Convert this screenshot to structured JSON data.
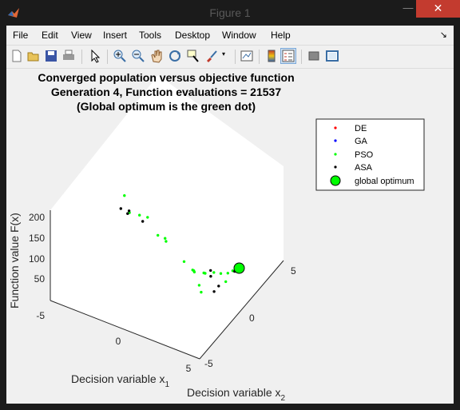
{
  "window": {
    "title": "Figure 1",
    "minimize": "—",
    "maximize": "☐",
    "close": "✕"
  },
  "menu": [
    {
      "label": "File"
    },
    {
      "label": "Edit"
    },
    {
      "label": "View"
    },
    {
      "label": "Insert"
    },
    {
      "label": "Tools"
    },
    {
      "label": "Desktop"
    },
    {
      "label": "Window"
    },
    {
      "label": "Help"
    }
  ],
  "toolbar_icons": [
    "new-figure-icon",
    "open-file-icon",
    "save-icon",
    "print-icon",
    "pointer-icon",
    "zoom-in-icon",
    "zoom-out-icon",
    "pan-icon",
    "rotate-3d-icon",
    "data-cursor-icon",
    "brush-icon",
    "link-plot-icon",
    "colorbar-icon",
    "legend-icon",
    "hide-plot-tools-icon",
    "show-plot-tools-icon"
  ],
  "plot": {
    "title_lines": [
      "Converged population versus objective function",
      "Generation 4, Function evaluations = 21537",
      "(Global optimum is the green dot)"
    ],
    "xlabel": "Decision variable x",
    "xlabel_sub": "1",
    "ylabel": "Decision variable x",
    "ylabel_sub": "2",
    "zlabel": "Function value F(x)",
    "x_ticks": [
      "-5",
      "0",
      "5"
    ],
    "y_ticks": [
      "-5",
      "0",
      "5"
    ],
    "z_ticks": [
      "50",
      "100",
      "150",
      "200"
    ]
  },
  "legend": [
    {
      "label": "DE",
      "color": "#ff0000",
      "marker": "dot"
    },
    {
      "label": "GA",
      "color": "#0000ff",
      "marker": "dot"
    },
    {
      "label": "PSO",
      "color": "#00ff00",
      "marker": "dot"
    },
    {
      "label": "ASA",
      "color": "#000000",
      "marker": "dot"
    },
    {
      "label": "global optimum",
      "color": "#00ff00",
      "marker": "circle"
    }
  ],
  "chart_data": {
    "type": "scatter",
    "title": "Converged population versus objective function\nGeneration 4, Function evaluations = 21537\n(Global optimum is the green dot)",
    "xlabel": "Decision variable x1",
    "ylabel": "Decision variable x2",
    "zlabel": "Function value F(x)",
    "xlim": [
      -5,
      5
    ],
    "ylim": [
      -5,
      5
    ],
    "zlim": [
      0,
      200
    ],
    "series": [
      {
        "name": "DE",
        "color": "#ff0000",
        "points": []
      },
      {
        "name": "GA",
        "color": "#0000ff",
        "points": []
      },
      {
        "name": "PSO",
        "color": "#00ff00",
        "points": [
          [
            -2.0,
            1.5,
            195
          ],
          [
            -1.5,
            1.8,
            170
          ],
          [
            -0.6,
            2.2,
            185
          ],
          [
            0.0,
            2.3,
            190
          ],
          [
            0.8,
            2.5,
            165
          ],
          [
            1.0,
            2.0,
            150
          ],
          [
            0.5,
            1.0,
            115
          ],
          [
            1.6,
            0.8,
            80
          ],
          [
            2.0,
            0.5,
            60
          ],
          [
            1.8,
            0.0,
            45
          ],
          [
            2.3,
            -0.3,
            40
          ],
          [
            2.5,
            0.6,
            35
          ],
          [
            2.8,
            0.9,
            30
          ],
          [
            1.5,
            -0.6,
            25
          ],
          [
            2.0,
            -1.0,
            20
          ],
          [
            2.3,
            -1.5,
            15
          ],
          [
            2.6,
            -1.8,
            10
          ],
          [
            2.9,
            -2.1,
            8
          ],
          [
            3.1,
            -1.5,
            5
          ],
          [
            3.0,
            -2.5,
            6
          ]
        ]
      },
      {
        "name": "ASA",
        "color": "#000000",
        "points": [
          [
            -2.3,
            1.4,
            160
          ],
          [
            -1.9,
            1.3,
            152
          ],
          [
            -0.5,
            2.0,
            168
          ],
          [
            -4.5,
            -3.5,
            20
          ],
          [
            3.6,
            1.2,
            95
          ],
          [
            4.0,
            1.5,
            60
          ],
          [
            3.8,
            0.6,
            50
          ],
          [
            2.6,
            -0.6,
            30
          ],
          [
            3.3,
            -2.2,
            15
          ]
        ]
      },
      {
        "name": "global optimum",
        "color": "#00ff00",
        "points": [
          [
            3.1,
            -3.1,
            0
          ]
        ]
      }
    ]
  }
}
